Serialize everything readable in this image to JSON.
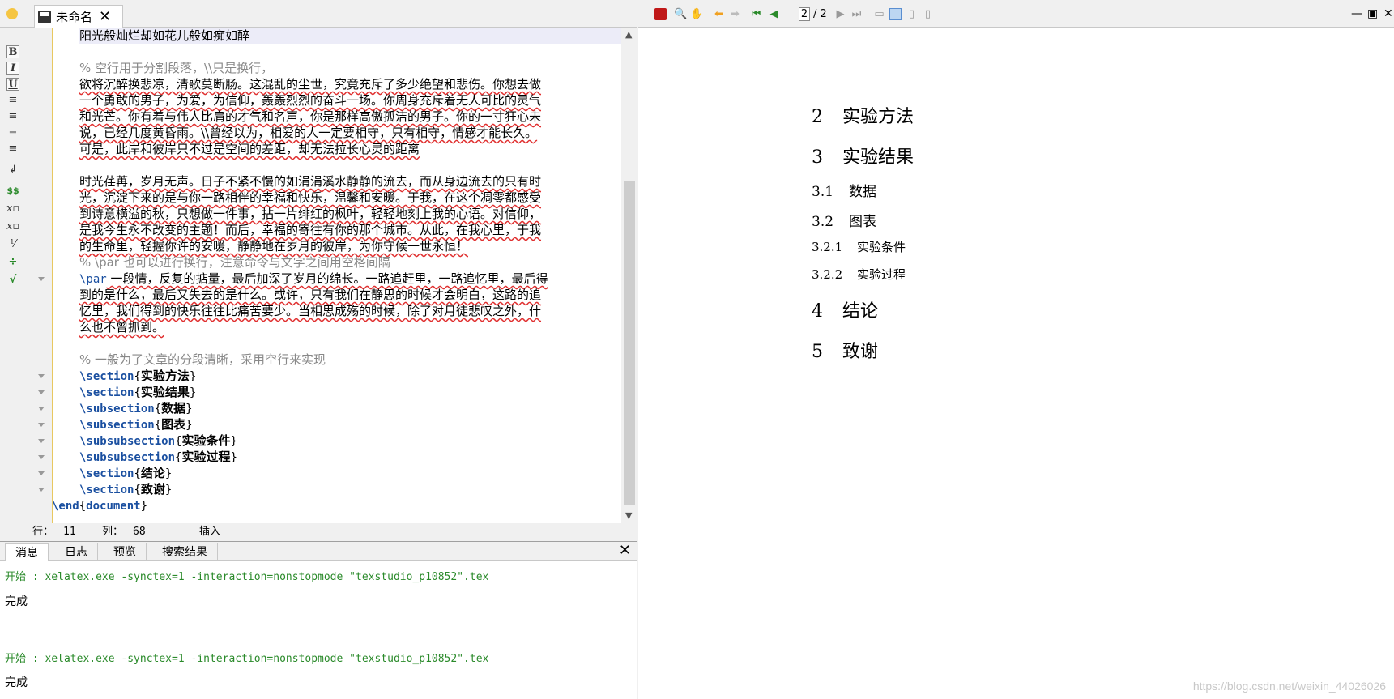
{
  "tab": {
    "title": "未命名"
  },
  "editor": {
    "lines": [
      {
        "text": "阳光般灿烂却如花儿般如痴如醉",
        "type": "text"
      },
      {
        "text": "",
        "type": "blank"
      },
      {
        "text": "% 空行用于分割段落，\\\\只是换行，",
        "type": "comment"
      },
      {
        "text": "欲将沉醉换悲凉，清歌莫断肠。这混乱的尘世，究竟充斥了多少绝望和悲伤。你想去做",
        "type": "text"
      },
      {
        "text": "一个勇敢的男子，为爱，为信仰，轰轰烈烈的奋斗一场。你周身充斥着无人可比的灵气",
        "type": "text"
      },
      {
        "text": "和光芒。你有着与伟人比肩的才气和名声，你是那样高傲孤洁的男子。你的一寸狂心未",
        "type": "text"
      },
      {
        "text": "说，已经几度黄昏雨。\\\\曾经以为，相爱的人一定要相守，只有相守，情感才能长久。",
        "type": "text"
      },
      {
        "text": "可是，此岸和彼岸只不过是空间的差距，却无法拉长心灵的距离",
        "type": "text"
      },
      {
        "text": "",
        "type": "blank"
      },
      {
        "text": "时光荏苒，岁月无声。日子不紧不慢的如涓涓溪水静静的流去，而从身边流去的只有时",
        "type": "text"
      },
      {
        "text": "光，沉淀下来的是与你一路相伴的幸福和快乐，温馨和安暖。于我，在这个凋零都感受",
        "type": "text"
      },
      {
        "text": "到诗意横溢的秋，只想做一件事，拈一片绯红的枫叶，轻轻地刻上我的心语。对信仰，",
        "type": "text"
      },
      {
        "text": "是我今生永不改变的主题！而后，幸福的寄往有你的那个城市。从此，在我心里，于我",
        "type": "text"
      },
      {
        "text": "的生命里，轻握你许的安暖，静静地在岁月的彼岸，为你守候一世永恒！",
        "type": "text"
      },
      {
        "text": "% \\par 也可以进行换行，注意命令与文字之间用空格间隔",
        "type": "comment"
      },
      {
        "cmd": "\\par",
        "text": " 一段情，反复的掂量，最后加深了岁月的绵长。一路追赶里，一路追忆里，最后得",
        "type": "par"
      },
      {
        "text": "到的是什么，最后又失去的是什么。或许，只有我们在静思的时候才会明白，这路的追",
        "type": "text"
      },
      {
        "text": "忆里，我们得到的快乐往往比痛苦要少。当相思成殇的时候，除了对月徒悲叹之外，什",
        "type": "text"
      },
      {
        "text": "么也不曾抓到。",
        "type": "text"
      },
      {
        "text": "",
        "type": "blank"
      },
      {
        "text": "% 一般为了文章的分段清晰，采用空行来实现",
        "type": "comment"
      },
      {
        "cmd": "\\section",
        "arg": "实验方法",
        "type": "cmd"
      },
      {
        "cmd": "\\section",
        "arg": "实验结果",
        "type": "cmd"
      },
      {
        "cmd": "\\subsection",
        "arg": "数据",
        "type": "cmd"
      },
      {
        "cmd": "\\subsection",
        "arg": "图表",
        "type": "cmd"
      },
      {
        "cmd": "\\subsubsection",
        "arg": "实验条件",
        "type": "cmd"
      },
      {
        "cmd": "\\subsubsection",
        "arg": "实验过程",
        "type": "cmd"
      },
      {
        "cmd": "\\section",
        "arg": "结论",
        "type": "cmd"
      },
      {
        "cmd": "\\section",
        "arg": "致谢",
        "type": "cmd"
      },
      {
        "cmd": "\\end",
        "arg": "document",
        "type": "end"
      }
    ]
  },
  "status": {
    "row_label": "行：",
    "row": "11",
    "col_label": "列：",
    "col": "68",
    "mode": "插入"
  },
  "messages": {
    "tabs": [
      "消息",
      "日志",
      "预览",
      "搜索结果"
    ],
    "close": "✕",
    "entries": [
      {
        "text": "开始 : xelatex.exe -synctex=1 -interaction=nonstopmode \"texstudio_p10852\".tex",
        "kind": "start"
      },
      {
        "text": "完成",
        "kind": "done"
      },
      {
        "text": "开始 : xelatex.exe -synctex=1 -interaction=nonstopmode \"texstudio_p10852\".tex",
        "kind": "start"
      },
      {
        "text": "完成",
        "kind": "done"
      }
    ]
  },
  "pdf": {
    "page_current": "2",
    "page_total": "/ 2",
    "toc": [
      {
        "num": "2",
        "title": "实验方法",
        "level": "sec"
      },
      {
        "num": "3",
        "title": "实验结果",
        "level": "sec"
      },
      {
        "num": "3.1",
        "title": "数据",
        "level": "sub"
      },
      {
        "num": "3.2",
        "title": "图表",
        "level": "sub"
      },
      {
        "num": "3.2.1",
        "title": "实验条件",
        "level": "subsub"
      },
      {
        "num": "3.2.2",
        "title": "实验过程",
        "level": "subsub"
      },
      {
        "num": "4",
        "title": "结论",
        "level": "sec"
      },
      {
        "num": "5",
        "title": "致谢",
        "level": "sec"
      }
    ]
  },
  "watermark": "https://blog.csdn.net/weixin_44026026",
  "icons": [
    "save-icon",
    "close-icon",
    "bold-icon",
    "italic-icon",
    "underline-icon",
    "align-left-icon",
    "align-center-icon",
    "align-right-icon",
    "justify-icon",
    "newline-icon",
    "math-icon",
    "subscript-icon",
    "superscript-icon",
    "zoom-icon",
    "hand-icon",
    "first-page-icon",
    "prev-page-icon",
    "next-page-icon",
    "last-page-icon"
  ]
}
